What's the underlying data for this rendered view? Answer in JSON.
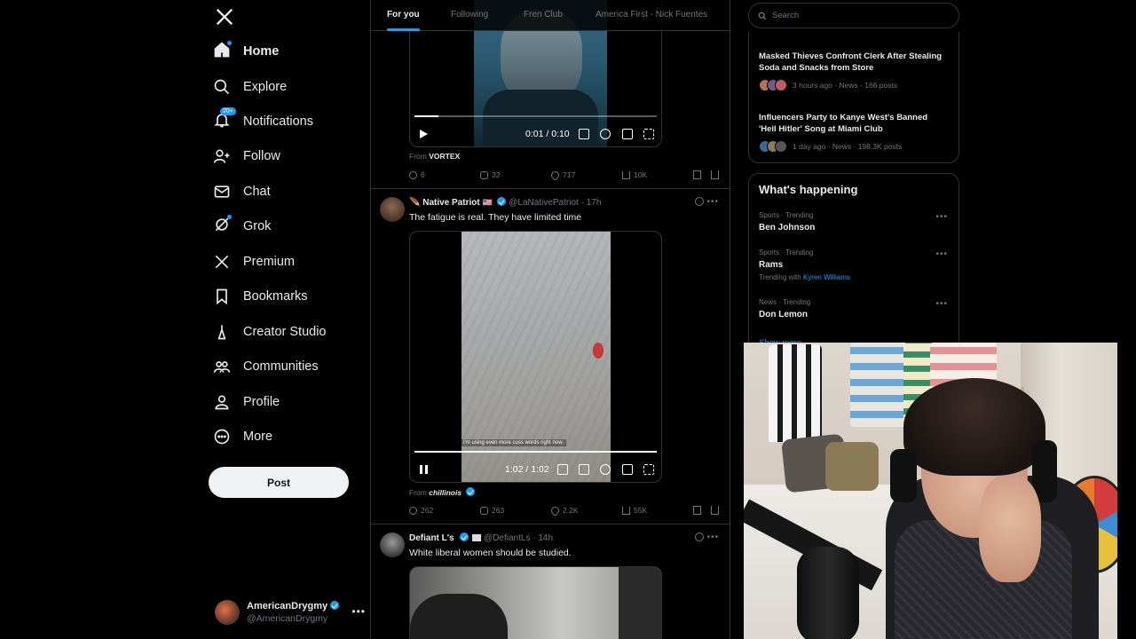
{
  "sidebar": {
    "nav": [
      {
        "label": "Home",
        "icon": "home-icon"
      },
      {
        "label": "Explore",
        "icon": "search-icon"
      },
      {
        "label": "Notifications",
        "icon": "bell-icon",
        "badge": "20+"
      },
      {
        "label": "Follow",
        "icon": "follow-icon"
      },
      {
        "label": "Chat",
        "icon": "mail-icon"
      },
      {
        "label": "Grok",
        "icon": "grok-icon"
      },
      {
        "label": "Premium",
        "icon": "x-icon"
      },
      {
        "label": "Bookmarks",
        "icon": "bookmark-icon"
      },
      {
        "label": "Creator Studio",
        "icon": "creator-studio-icon"
      },
      {
        "label": "Communities",
        "icon": "communities-icon"
      },
      {
        "label": "Profile",
        "icon": "profile-icon"
      },
      {
        "label": "More",
        "icon": "more-icon"
      }
    ],
    "post_label": "Post",
    "account": {
      "name": "AmericanDrygmy",
      "handle": "@AmericanDrygmy"
    }
  },
  "timeline": {
    "tabs": [
      "For you",
      "Following",
      "Fren Club",
      "America First - Nick Fuentes"
    ],
    "post1": {
      "time_display": "0:01 / 0:10",
      "progress": 0.1,
      "from_label": "From",
      "from_name": "VORTEX",
      "replies": "6",
      "reposts": "32",
      "likes": "717",
      "views": "10K"
    },
    "post2": {
      "name": "Native Patriot",
      "handle": "@LaNativePatriot",
      "age": "17h",
      "text": "The fatigue is real. They have limited time",
      "time_display": "1:02 / 1:02",
      "progress": 1.0,
      "caption": "I'm using even more cuss words right now.",
      "from_label": "From",
      "from_name": "chillinois",
      "replies": "262",
      "reposts": "263",
      "likes": "2.2K",
      "views": "55K"
    },
    "post3": {
      "name": "Defiant L's",
      "handle": "@DefiantLs",
      "age": "14h",
      "text": "White liberal women should be studied."
    }
  },
  "right": {
    "search_placeholder": "Search",
    "news": [
      {
        "title": "Masked Thieves Confront Clerk After Stealing Soda and Snacks from Store",
        "meta": "3 hours ago · News · 166 posts"
      },
      {
        "title": "Influencers Party to Kanye West's Banned 'Heil Hitler' Song at Miami Club",
        "meta": "1 day ago · News · 198.3K posts"
      }
    ],
    "whats_happening": "What's happening",
    "trends": [
      {
        "category": "Sports · Trending",
        "name": "Ben Johnson"
      },
      {
        "category": "Sports · Trending",
        "name": "Rams",
        "with_label": "Trending with",
        "with_link": "Kyren Williams"
      },
      {
        "category": "News · Trending",
        "name": "Don Lemon"
      }
    ],
    "show_more": "Show more"
  },
  "colors": {
    "accent": "#1d9bf0",
    "background": "#000000",
    "border": "#2f3336",
    "muted": "#71767b"
  }
}
